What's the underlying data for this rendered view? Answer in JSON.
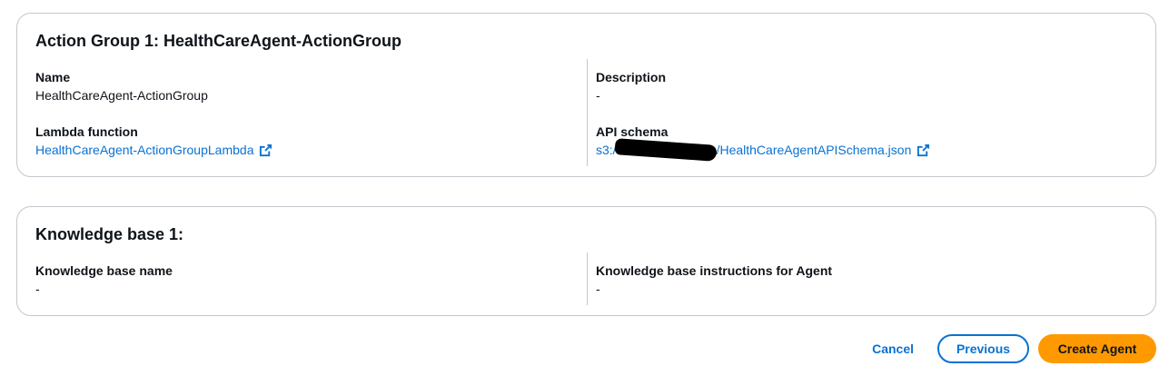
{
  "action_group": {
    "title": "Action Group 1: HealthCareAgent-ActionGroup",
    "name_label": "Name",
    "name_value": "HealthCareAgent-ActionGroup",
    "description_label": "Description",
    "description_value": "-",
    "lambda_label": "Lambda function",
    "lambda_value": "HealthCareAgent-ActionGroupLambda",
    "api_schema_label": "API schema",
    "api_schema_prefix": "s3:/",
    "api_schema_suffix": "/HealthCareAgentAPISchema.json"
  },
  "knowledge_base": {
    "title": "Knowledge base 1:",
    "name_label": "Knowledge base name",
    "name_value": "-",
    "instructions_label": "Knowledge base instructions for Agent",
    "instructions_value": "-"
  },
  "footer": {
    "cancel_label": "Cancel",
    "previous_label": "Previous",
    "create_label": "Create Agent"
  },
  "icons": {
    "external_link": "external-link-icon"
  },
  "colors": {
    "link": "#0972d3",
    "primary_button": "#ff9900",
    "border": "#c6c6cd"
  }
}
